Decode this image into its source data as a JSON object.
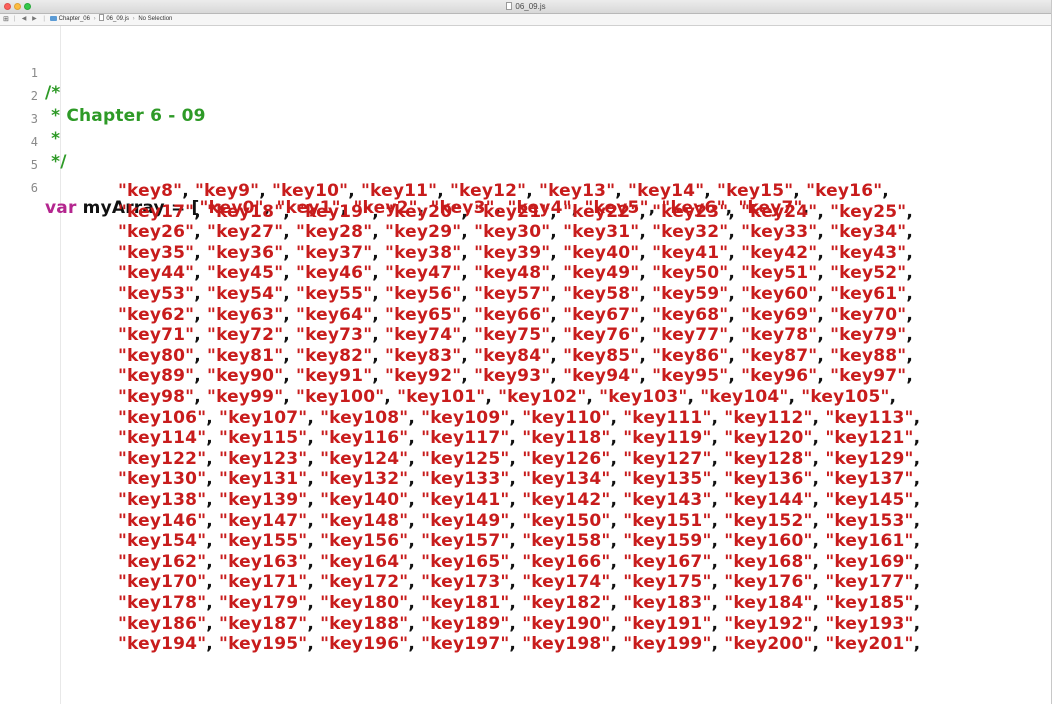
{
  "window": {
    "title": "06_09.js"
  },
  "jumpbar": {
    "crumbs": [
      "Chapter_06",
      "06_09.js",
      "No Selection"
    ]
  },
  "editor": {
    "comment_lines": [
      {
        "number": "1",
        "text": "/*"
      },
      {
        "number": "2",
        "text": " * Chapter 6 - 09"
      },
      {
        "number": "3",
        "text": " *"
      },
      {
        "number": "4",
        "text": " */"
      },
      {
        "number": "5",
        "text": ""
      }
    ],
    "code_line": {
      "number": "6",
      "keyword": "var",
      "identifier": "myArray",
      "operator": "=",
      "open_bracket": "["
    },
    "array_rows": [
      [
        "key0",
        "key1",
        "key2",
        "key3",
        "key4",
        "key5",
        "key6",
        "key7"
      ],
      [
        "key8",
        "key9",
        "key10",
        "key11",
        "key12",
        "key13",
        "key14",
        "key15",
        "key16"
      ],
      [
        "key17",
        "key18",
        "key19",
        "key20",
        "key21",
        "key22",
        "key23",
        "key24",
        "key25"
      ],
      [
        "key26",
        "key27",
        "key28",
        "key29",
        "key30",
        "key31",
        "key32",
        "key33",
        "key34"
      ],
      [
        "key35",
        "key36",
        "key37",
        "key38",
        "key39",
        "key40",
        "key41",
        "key42",
        "key43"
      ],
      [
        "key44",
        "key45",
        "key46",
        "key47",
        "key48",
        "key49",
        "key50",
        "key51",
        "key52"
      ],
      [
        "key53",
        "key54",
        "key55",
        "key56",
        "key57",
        "key58",
        "key59",
        "key60",
        "key61"
      ],
      [
        "key62",
        "key63",
        "key64",
        "key65",
        "key66",
        "key67",
        "key68",
        "key69",
        "key70"
      ],
      [
        "key71",
        "key72",
        "key73",
        "key74",
        "key75",
        "key76",
        "key77",
        "key78",
        "key79"
      ],
      [
        "key80",
        "key81",
        "key82",
        "key83",
        "key84",
        "key85",
        "key86",
        "key87",
        "key88"
      ],
      [
        "key89",
        "key90",
        "key91",
        "key92",
        "key93",
        "key94",
        "key95",
        "key96",
        "key97"
      ],
      [
        "key98",
        "key99",
        "key100",
        "key101",
        "key102",
        "key103",
        "key104",
        "key105"
      ],
      [
        "key106",
        "key107",
        "key108",
        "key109",
        "key110",
        "key111",
        "key112",
        "key113"
      ],
      [
        "key114",
        "key115",
        "key116",
        "key117",
        "key118",
        "key119",
        "key120",
        "key121"
      ],
      [
        "key122",
        "key123",
        "key124",
        "key125",
        "key126",
        "key127",
        "key128",
        "key129"
      ],
      [
        "key130",
        "key131",
        "key132",
        "key133",
        "key134",
        "key135",
        "key136",
        "key137"
      ],
      [
        "key138",
        "key139",
        "key140",
        "key141",
        "key142",
        "key143",
        "key144",
        "key145"
      ],
      [
        "key146",
        "key147",
        "key148",
        "key149",
        "key150",
        "key151",
        "key152",
        "key153"
      ],
      [
        "key154",
        "key155",
        "key156",
        "key157",
        "key158",
        "key159",
        "key160",
        "key161"
      ],
      [
        "key162",
        "key163",
        "key164",
        "key165",
        "key166",
        "key167",
        "key168",
        "key169"
      ],
      [
        "key170",
        "key171",
        "key172",
        "key173",
        "key174",
        "key175",
        "key176",
        "key177"
      ],
      [
        "key178",
        "key179",
        "key180",
        "key181",
        "key182",
        "key183",
        "key184",
        "key185"
      ],
      [
        "key186",
        "key187",
        "key188",
        "key189",
        "key190",
        "key191",
        "key192",
        "key193"
      ],
      [
        "key194",
        "key195",
        "key196",
        "key197",
        "key198",
        "key199",
        "key200",
        "key201"
      ]
    ]
  }
}
